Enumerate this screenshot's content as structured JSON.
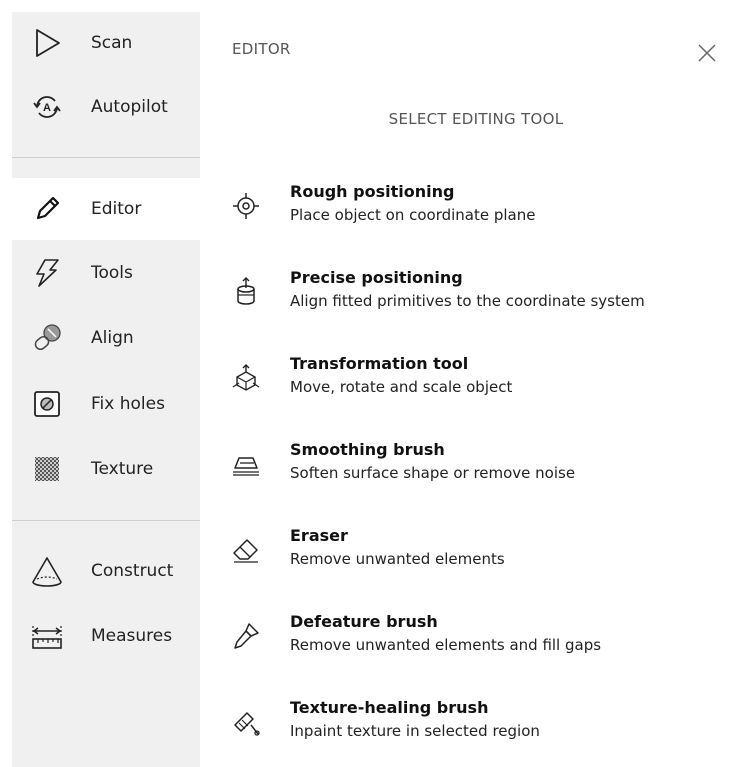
{
  "sidebar": {
    "items": [
      {
        "label": "Scan",
        "icon": "play-triangle-icon"
      },
      {
        "label": "Autopilot",
        "icon": "autopilot-icon"
      },
      {
        "label": "Editor",
        "icon": "pencil-icon",
        "active": true
      },
      {
        "label": "Tools",
        "icon": "lightning-icon"
      },
      {
        "label": "Align",
        "icon": "align-icon"
      },
      {
        "label": "Fix holes",
        "icon": "fix-holes-icon"
      },
      {
        "label": "Texture",
        "icon": "texture-icon"
      },
      {
        "label": "Construct",
        "icon": "construct-icon"
      },
      {
        "label": "Measures",
        "icon": "ruler-icon"
      }
    ]
  },
  "panel": {
    "title": "EDITOR",
    "section_title": "SELECT EDITING TOOL",
    "tools": [
      {
        "name": "Rough positioning",
        "description": "Place object on coordinate plane",
        "icon": "crosshair-icon"
      },
      {
        "name": "Precise positioning",
        "description": "Align fitted primitives to the coordinate system",
        "icon": "cylinder-icon"
      },
      {
        "name": "Transformation tool",
        "description": "Move, rotate and scale object",
        "icon": "transform-icon"
      },
      {
        "name": "Smoothing brush",
        "description": "Soften surface shape or remove noise",
        "icon": "iron-icon"
      },
      {
        "name": "Eraser",
        "description": "Remove unwanted elements",
        "icon": "eraser-icon"
      },
      {
        "name": "Defeature brush",
        "description": "Remove unwanted elements and fill gaps",
        "icon": "defeature-brush-icon"
      },
      {
        "name": "Texture-healing brush",
        "description": "Inpaint texture in selected region",
        "icon": "healing-brush-icon"
      }
    ]
  },
  "colors": {
    "sidebar_bg": "#f0f0f0",
    "active_bg": "#ffffff",
    "text": "#1b1b1b",
    "muted": "#555555"
  }
}
